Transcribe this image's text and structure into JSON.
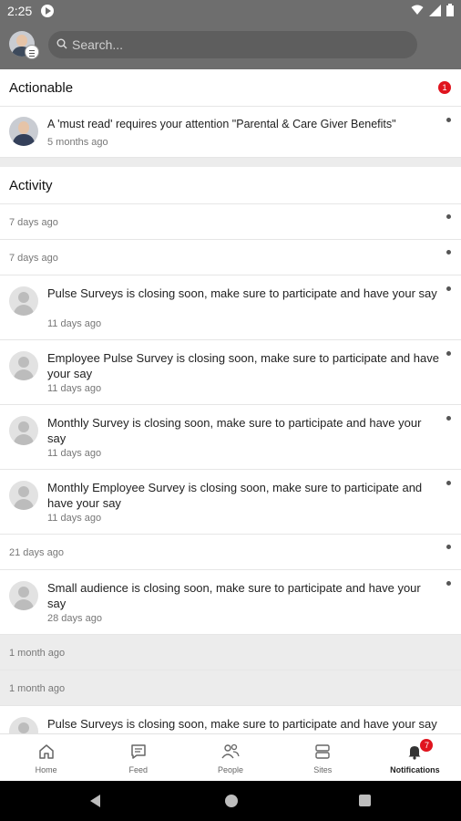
{
  "status_bar": {
    "time": "2:25"
  },
  "search": {
    "placeholder": "Search..."
  },
  "actionable": {
    "title": "Actionable",
    "count": "1",
    "items": [
      {
        "message": "A 'must read' requires your attention \"Parental & Care Giver Benefits\"",
        "time": "5 months ago"
      }
    ]
  },
  "activity": {
    "title": "Activity",
    "entries": [
      {
        "date_label": "7 days ago"
      },
      {
        "date_label": "7 days ago"
      },
      {
        "message": "Pulse Surveys is closing soon, make sure to participate and have your say",
        "time": "11 days ago"
      },
      {
        "message": "Employee Pulse Survey is closing soon, make sure to participate and have your say",
        "time": "11 days ago"
      },
      {
        "message": "Monthly Survey is closing soon, make sure to participate and have your say",
        "time": "11 days ago"
      },
      {
        "message": "Monthly Employee Survey is closing soon, make sure to participate and have your say",
        "time": "11 days ago"
      },
      {
        "date_label": "21 days ago"
      },
      {
        "message": "Small audience is closing soon, make sure to participate and have your say",
        "time": "28 days ago"
      },
      {
        "date_label": "1 month ago"
      },
      {
        "date_label": "1 month ago"
      },
      {
        "message": "Pulse Surveys is closing soon, make sure to participate and have your say",
        "time": ""
      }
    ]
  },
  "bottom_nav": {
    "items": [
      {
        "label": "Home",
        "icon": "home-icon"
      },
      {
        "label": "Feed",
        "icon": "feed-icon"
      },
      {
        "label": "People",
        "icon": "people-icon"
      },
      {
        "label": "Sites",
        "icon": "sites-icon"
      },
      {
        "label": "Notifications",
        "icon": "bell-icon",
        "badge": "7",
        "active": true
      }
    ]
  },
  "colors": {
    "app_bar": "#6e6e6e",
    "badge": "#e0141e",
    "section_bg": "#ececec"
  }
}
